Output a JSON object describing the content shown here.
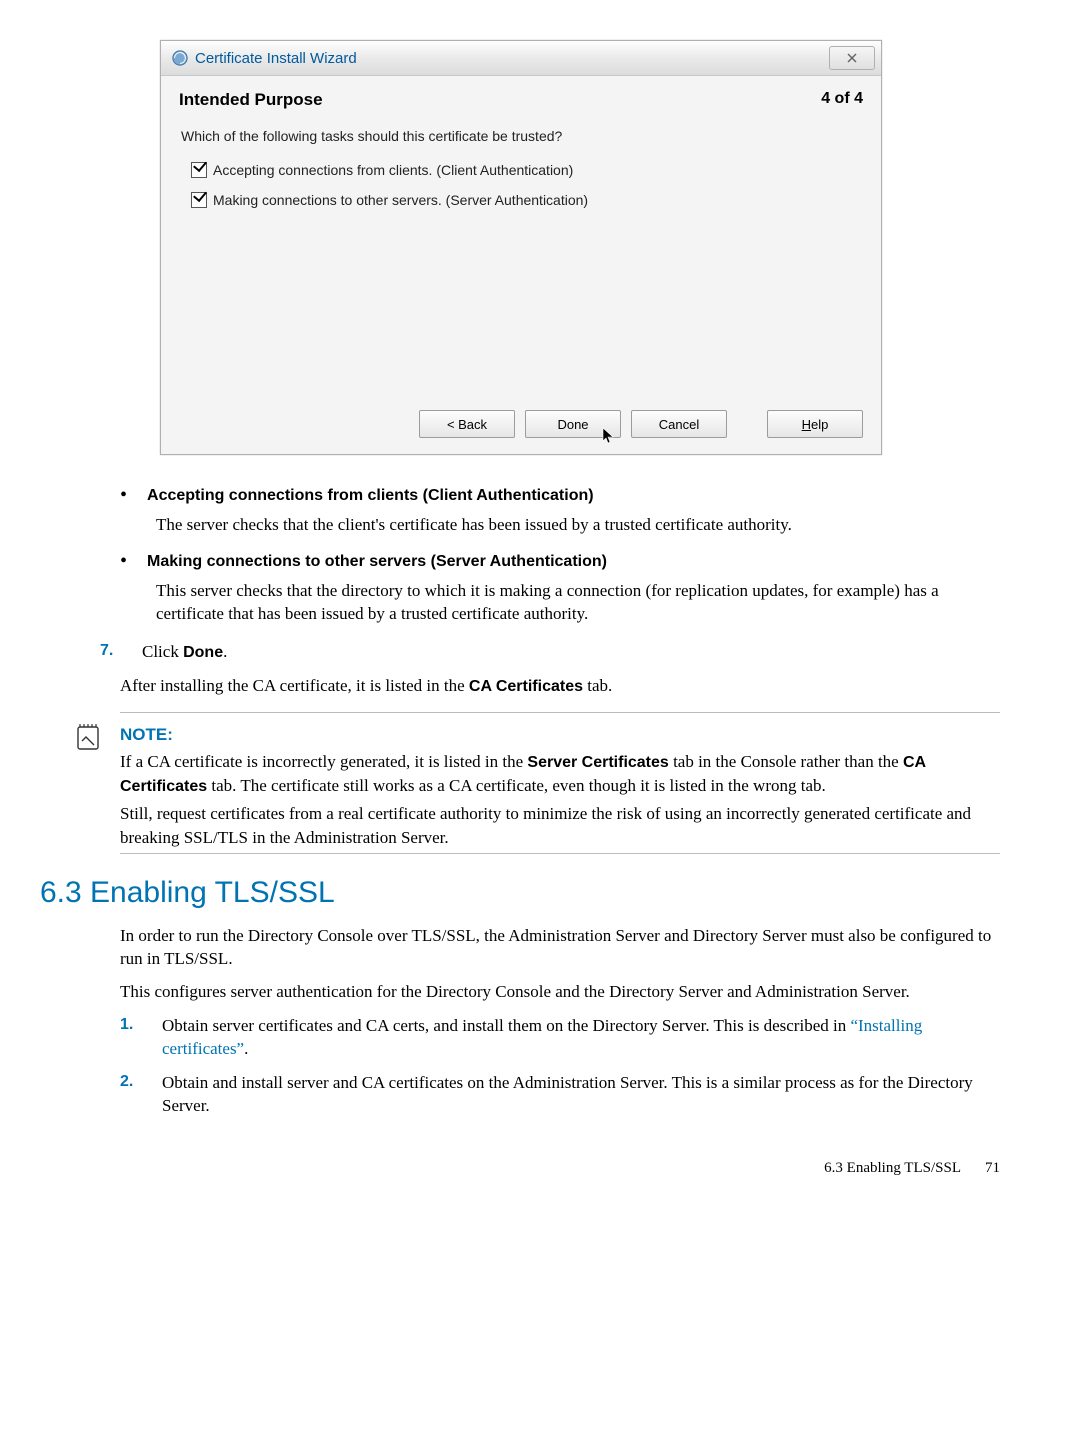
{
  "dialog": {
    "title": "Certificate Install Wizard",
    "close": "✕",
    "heading": "Intended Purpose",
    "step": "4 of 4",
    "question": "Which of the following tasks should this certificate be trusted?",
    "option1": "Accepting connections from clients.  (Client Authentication)",
    "option2": "Making connections to other servers. (Server Authentication)",
    "back": "< Back",
    "done": "Done",
    "cancel": "Cancel",
    "help_pre": "H",
    "help_post": "elp"
  },
  "bullets": {
    "b1_head": "Accepting connections from clients (Client Authentication)",
    "b1_body": "The server checks that the client's certificate has been issued by a trusted certificate authority.",
    "b2_head": "Making connections to other servers (Server Authentication)",
    "b2_body": "This server checks that the directory to which it is making a connection (for replication updates, for example) has a certificate that has been issued by a trusted certificate authority."
  },
  "step7": {
    "num": "7.",
    "text_pre": "Click ",
    "text_bold": "Done",
    "text_post": "."
  },
  "after": {
    "pre": "After installing the CA certificate, it is listed in the ",
    "bold": "CA Certificates",
    "post": " tab."
  },
  "note": {
    "label": "NOTE:",
    "p1a": "If a CA certificate is incorrectly generated, it is listed in the ",
    "p1b": "Server Certificates",
    "p1c": " tab in the Console rather than the ",
    "p1d": "CA Certificates",
    "p1e": " tab. The certificate still works as a CA certificate, even though it is listed in the wrong tab.",
    "p2": "Still, request certificates from a real certificate authority to minimize the risk of using an incorrectly generated certificate and breaking SSL/TLS in the Administration Server."
  },
  "section": {
    "title": "6.3 Enabling TLS/SSL",
    "p1": "In order to run the Directory Console over TLS/SSL, the Administration Server and Directory Server must also be configured to run in TLS/SSL.",
    "p2": "This configures server authentication for the Directory Console and the Directory Server and Administration Server.",
    "item1_num": "1.",
    "item1a": "Obtain server certificates and CA certs, and install them on the Directory Server. This is described in ",
    "item1link": "“Installing certificates”",
    "item1b": ".",
    "item2_num": "2.",
    "item2": "Obtain and install server and CA certificates on the Administration Server. This is a similar process as for the Directory Server."
  },
  "footer": {
    "text": "6.3 Enabling TLS/SSL",
    "page": "71"
  }
}
